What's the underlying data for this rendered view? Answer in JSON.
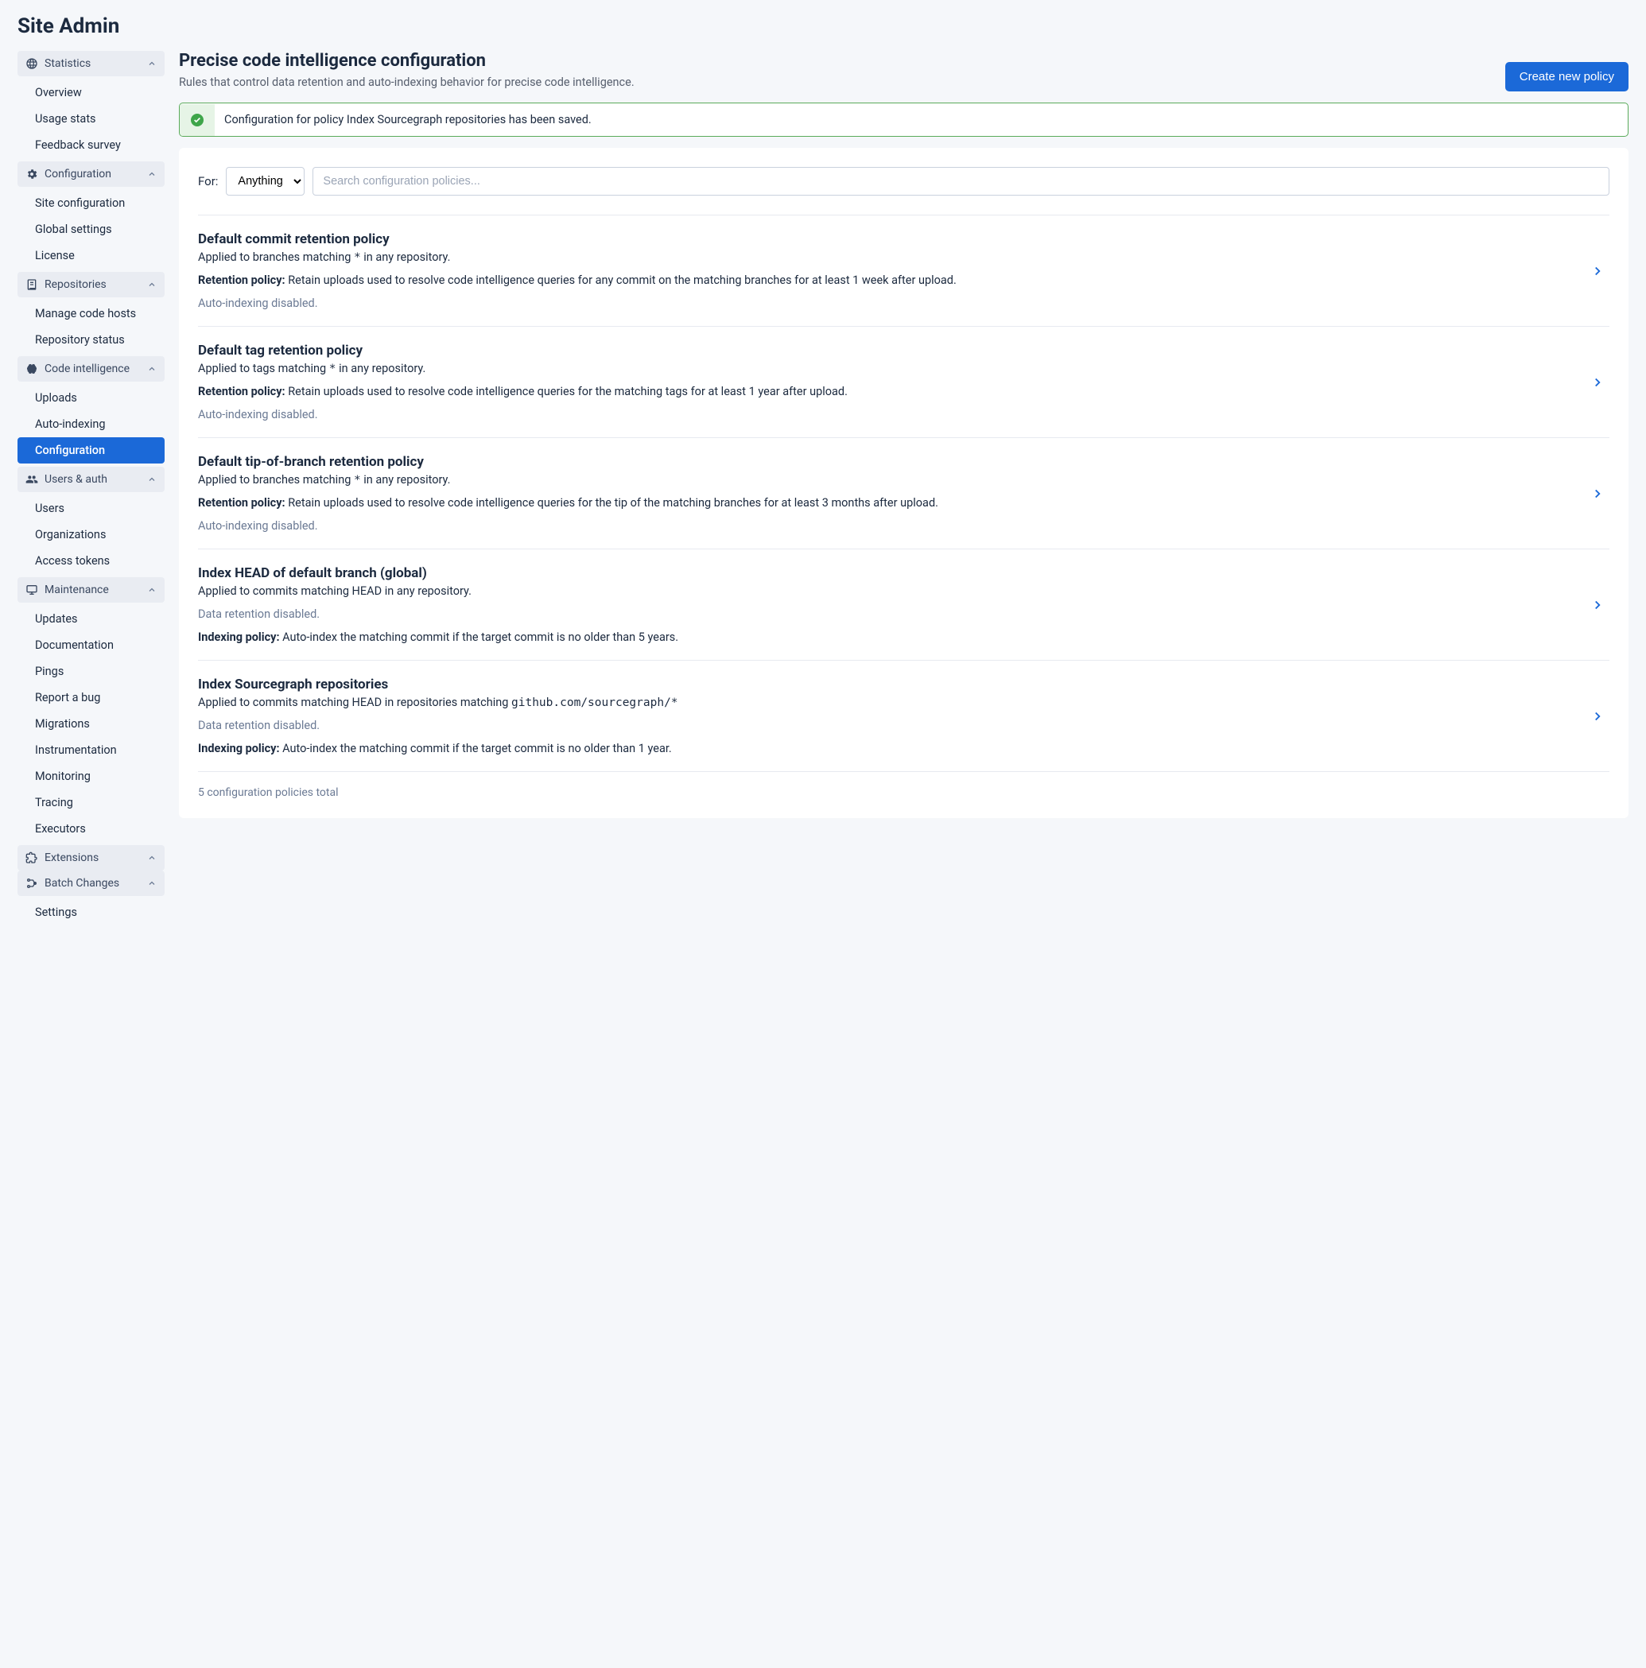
{
  "pageTitle": "Site Admin",
  "sidebar": {
    "sections": [
      {
        "label": "Statistics",
        "icon": "globe",
        "items": [
          "Overview",
          "Usage stats",
          "Feedback survey"
        ]
      },
      {
        "label": "Configuration",
        "icon": "gears",
        "items": [
          "Site configuration",
          "Global settings",
          "License"
        ]
      },
      {
        "label": "Repositories",
        "icon": "repo",
        "items": [
          "Manage code hosts",
          "Repository status"
        ]
      },
      {
        "label": "Code intelligence",
        "icon": "brain",
        "items": [
          "Uploads",
          "Auto-indexing",
          "Configuration"
        ],
        "activeIndex": 2
      },
      {
        "label": "Users & auth",
        "icon": "users",
        "items": [
          "Users",
          "Organizations",
          "Access tokens"
        ]
      },
      {
        "label": "Maintenance",
        "icon": "monitor",
        "items": [
          "Updates",
          "Documentation",
          "Pings",
          "Report a bug",
          "Migrations",
          "Instrumentation",
          "Monitoring",
          "Tracing",
          "Executors"
        ]
      },
      {
        "label": "Extensions",
        "icon": "puzzle",
        "items": []
      },
      {
        "label": "Batch Changes",
        "icon": "batch",
        "items": [
          "Settings"
        ]
      }
    ]
  },
  "header": {
    "title": "Precise code intelligence configuration",
    "subtitle": "Rules that control data retention and auto-indexing behavior for precise code intelligence.",
    "createButton": "Create new policy"
  },
  "alert": {
    "text": "Configuration for policy Index Sourcegraph repositories has been saved."
  },
  "filter": {
    "label": "For:",
    "selectValue": "Anything",
    "searchPlaceholder": "Search configuration policies..."
  },
  "policies": [
    {
      "title": "Default commit retention policy",
      "appliedPrefix": "Applied to branches matching ",
      "appliedPattern": "*",
      "appliedSuffix": " in any repository.",
      "retentionLabel": "Retention policy:",
      "retentionText": " Retain uploads used to resolve code intelligence queries for any commit on the matching branches for at least 1 week after upload.",
      "autoIndexDisabled": "Auto-indexing disabled."
    },
    {
      "title": "Default tag retention policy",
      "appliedPrefix": "Applied to tags matching ",
      "appliedPattern": "*",
      "appliedSuffix": " in any repository.",
      "retentionLabel": "Retention policy:",
      "retentionText": " Retain uploads used to resolve code intelligence queries for the matching tags for at least 1 year after upload.",
      "autoIndexDisabled": "Auto-indexing disabled."
    },
    {
      "title": "Default tip-of-branch retention policy",
      "appliedPrefix": "Applied to branches matching ",
      "appliedPattern": "*",
      "appliedSuffix": " in any repository.",
      "retentionLabel": "Retention policy:",
      "retentionText": " Retain uploads used to resolve code intelligence queries for the tip of the matching branches for at least 3 months after upload.",
      "autoIndexDisabled": "Auto-indexing disabled."
    },
    {
      "title": "Index HEAD of default branch (global)",
      "appliedPrefix": "Applied to commits matching HEAD in any repository.",
      "appliedPattern": "",
      "appliedSuffix": "",
      "dataRetentionDisabled": "Data retention disabled.",
      "indexingLabel": "Indexing policy:",
      "indexingText": " Auto-index the matching commit if the target commit is no older than 5 years."
    },
    {
      "title": "Index Sourcegraph repositories",
      "appliedPrefix": "Applied to commits matching HEAD in repositories matching ",
      "appliedMono": "github.com/sourcegraph/*",
      "appliedSuffix": "",
      "dataRetentionDisabled": "Data retention disabled.",
      "indexingLabel": "Indexing policy:",
      "indexingText": " Auto-index the matching commit if the target commit is no older than 1 year."
    }
  ],
  "footer": {
    "count": "5 configuration policies total"
  }
}
